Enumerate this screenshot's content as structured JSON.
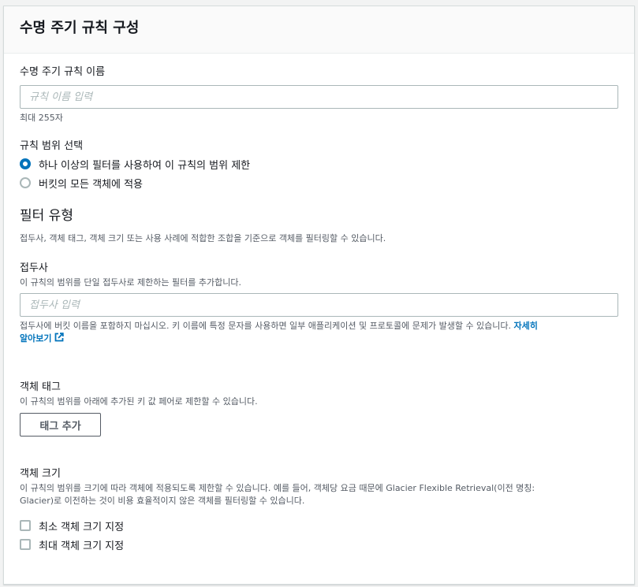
{
  "panel": {
    "title": "수명 주기 규칙 구성"
  },
  "rule_name": {
    "label": "수명 주기 규칙 이름",
    "placeholder": "규칙 이름 입력",
    "hint": "최대 255자"
  },
  "scope": {
    "label": "규칙 범위 선택",
    "options": [
      {
        "label": "하나 이상의 필터를 사용하여 이 규칙의 범위 제한",
        "selected": true
      },
      {
        "label": "버킷의 모든 객체에 적용",
        "selected": false
      }
    ]
  },
  "filter_type": {
    "title": "필터 유형",
    "description": "접두사, 객체 태그, 객체 크기 또는 사용 사례에 적합한 조합을 기준으로 객체를 필터링할 수 있습니다."
  },
  "prefix": {
    "label": "접두사",
    "description": "이 규칙의 범위를 단일 접두사로 제한하는 필터를 추가합니다.",
    "placeholder": "접두사 입력",
    "warning": "접두사에 버킷 이름을 포함하지 마십시오. 키 이름에 특정 문자를 사용하면 일부 애플리케이션 및 프로토콜에 문제가 발생할 수 있습니다.",
    "link_line1": "자세히",
    "link_line2": "알아보기"
  },
  "object_tags": {
    "label": "객체 태그",
    "description": "이 규칙의 범위를 아래에 추가된 키 값 페어로 제한할 수 있습니다.",
    "add_button": "태그 추가"
  },
  "object_size": {
    "label": "객체 크기",
    "description_line1": "이 규칙의 범위를 크기에 따라 객체에 적용되도록 제한할 수 있습니다. 예를 들어, 객체당 요금 때문에 Glacier Flexible Retrieval(이전 명칭:",
    "description_line2": "Glacier)로 이전하는 것이 비용 효율적이지 않은 객체를 필터링할 수 있습니다.",
    "min_label": "최소 객체 크기 지정",
    "max_label": "최대 객체 크기 지정"
  },
  "colors": {
    "accent": "#0073bb",
    "border": "#aab7b8",
    "muted": "#545b64"
  }
}
